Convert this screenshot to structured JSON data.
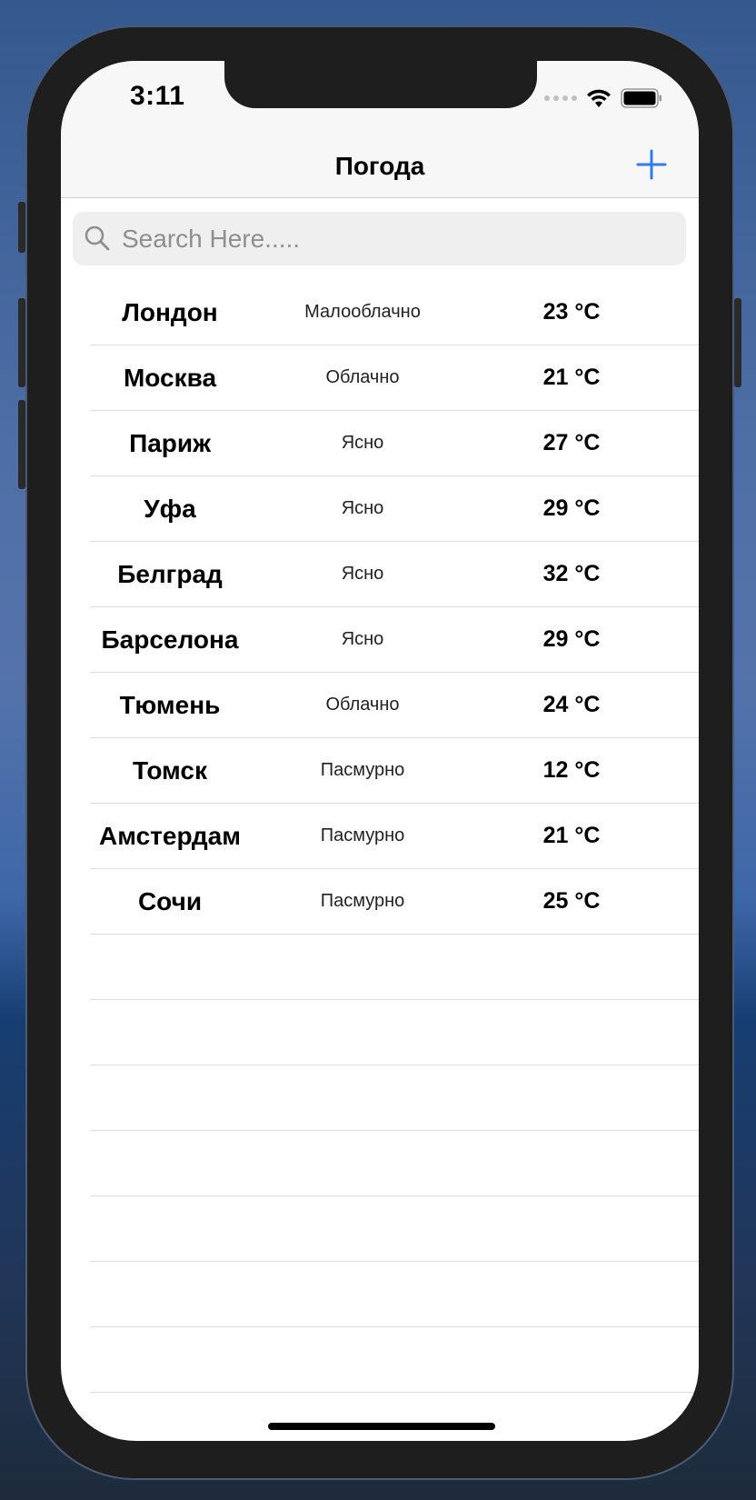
{
  "status_bar": {
    "time": "3:11"
  },
  "nav": {
    "title": "Погода",
    "add_label": "+"
  },
  "search": {
    "placeholder": "Search Here....."
  },
  "rows": [
    {
      "city": "Лондон",
      "condition": "Малооблачно",
      "temp": "23 °C"
    },
    {
      "city": "Москва",
      "condition": "Облачно",
      "temp": "21 °C"
    },
    {
      "city": "Париж",
      "condition": "Ясно",
      "temp": "27 °C"
    },
    {
      "city": "Уфа",
      "condition": "Ясно",
      "temp": "29 °C"
    },
    {
      "city": "Белград",
      "condition": "Ясно",
      "temp": "32 °C"
    },
    {
      "city": "Барселона",
      "condition": "Ясно",
      "temp": "29 °C"
    },
    {
      "city": "Тюмень",
      "condition": "Облачно",
      "temp": "24 °C"
    },
    {
      "city": "Томск",
      "condition": "Пасмурно",
      "temp": "12 °C"
    },
    {
      "city": "Амстердам",
      "condition": "Пасмурно",
      "temp": "21 °C"
    },
    {
      "city": "Сочи",
      "condition": "Пасмурно",
      "temp": "25 °C"
    }
  ],
  "colors": {
    "accent": "#2d7cf6",
    "background": "#ffffff",
    "bar": "#f7f7f7"
  },
  "icons": {
    "add": "plus-icon",
    "search": "search-icon",
    "wifi": "wifi-icon",
    "battery": "battery-icon",
    "signal": "signal-icon"
  }
}
